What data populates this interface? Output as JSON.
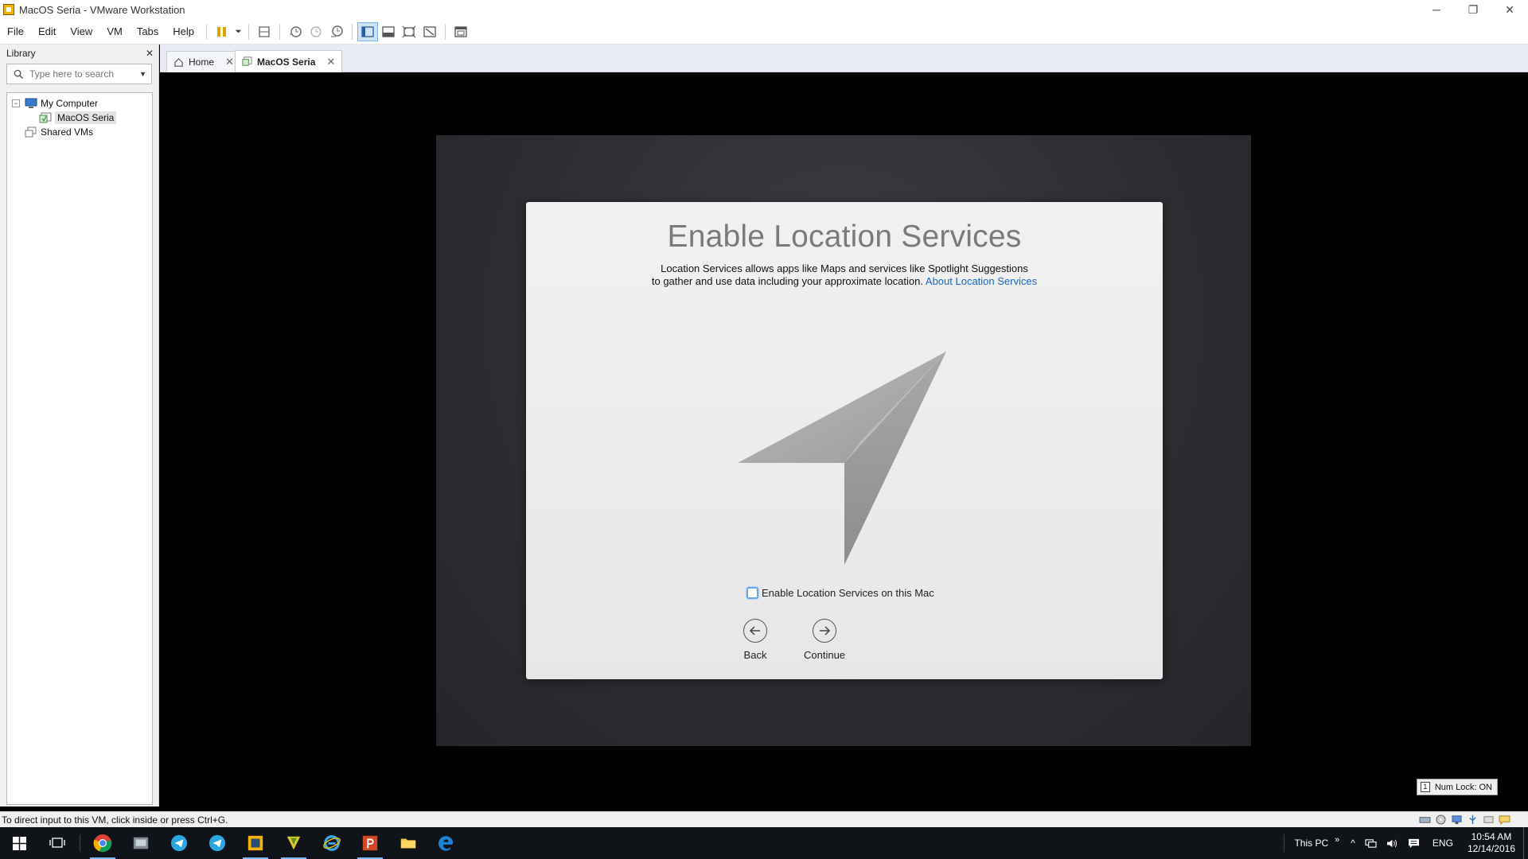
{
  "window": {
    "title": "MacOS Seria - VMware Workstation",
    "controls": {
      "minimize": "─",
      "restore": "❐",
      "close": "✕"
    }
  },
  "menu": [
    "File",
    "Edit",
    "View",
    "VM",
    "Tabs",
    "Help"
  ],
  "library": {
    "title": "Library",
    "close": "✕",
    "search_placeholder": "Type here to search",
    "tree": {
      "expander": "−",
      "my_computer": "My Computer",
      "vm": "MacOS Seria",
      "shared": "Shared VMs"
    }
  },
  "tabs": [
    {
      "label": "Home",
      "close": "✕"
    },
    {
      "label": "MacOS Seria",
      "close": "✕"
    }
  ],
  "dialog": {
    "title": "Enable Location Services",
    "line1": "Location Services allows apps like Maps and services like Spotlight Suggestions",
    "line2": "to gather and use data including your approximate location.",
    "link": "About Location Services",
    "checkbox_label": "Enable Location Services on this Mac",
    "checkbox_checked": false,
    "back_label": "Back",
    "continue_label": "Continue"
  },
  "numlock": {
    "key": "1",
    "label": "Num Lock: ON"
  },
  "statusbar": {
    "message": "To direct input to this VM, click inside or press Ctrl+G."
  },
  "taskbar": {
    "this_pc": "This PC",
    "chevron": "»",
    "caret": "^",
    "lang": "ENG",
    "time": "10:54 AM",
    "date": "12/14/2016"
  },
  "colors": {
    "accent": "#1a67c2",
    "checkbox_border": "#6aa8ec",
    "toolbar_active": "#cfe3f7"
  }
}
